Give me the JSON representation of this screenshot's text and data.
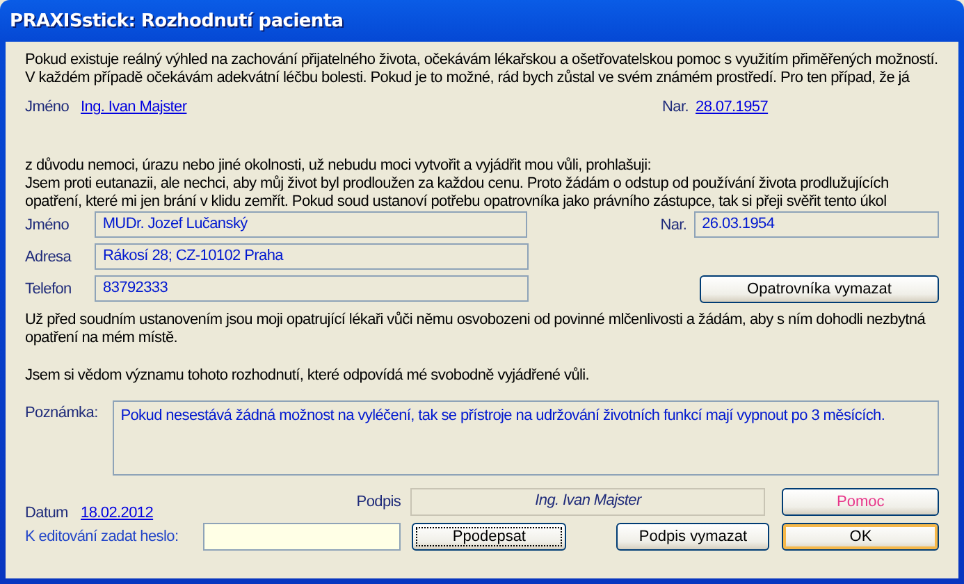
{
  "window": {
    "title": "PRAXISstick: Rozhodnutí pacienta"
  },
  "intro": "Pokud existuje reálný výhled na zachování přijatelného života, očekávám lékařskou a ošetřovatelskou pomoc s využitím přiměřených možností. V každém případě očekávám adekvátní léčbu bolesti. Pokud je to možné, rád bych zůstal ve svém známém prostředí. Pro ten případ, že já",
  "patient": {
    "name_label": "Jméno",
    "name": "Ing. Ivan Majster",
    "birth_label": "Nar.",
    "birth": "28.07.1957"
  },
  "declaration_lead": "z důvodu nemoci, úrazu nebo jiné okolnosti, už nebudu moci vytvořit a vyjádřit mou vůli, prohlašuji:",
  "declaration": "Jsem proti eutanazii, ale nechci, aby můj život byl prodloužen za každou cenu. Proto žádám o odstup od používání života prodlužujících opatření, které mi jen brání v klidu zemřít. Pokud soud ustanoví potřebu opatrovníka jako právního zástupce, tak si přeji svěřit tento úkol",
  "guardian": {
    "fields": [
      {
        "label": "Jméno",
        "value": "MUDr. Jozef Lučanský"
      },
      {
        "label": "Adresa",
        "value": "Rákosí 28; CZ-10102 Praha"
      },
      {
        "label": "Telefon",
        "value": "83792333"
      }
    ],
    "birth_label": "Nar.",
    "birth": "26.03.1954",
    "clear_button": "Opatrovníka vymazat"
  },
  "release_text": "Už před soudním ustanovením jsou moji opatrující lékaři vůči němu osvobozeni od povinné mlčenlivosti a žádám, aby s ním dohodli nezbytná opatření na mém místě.",
  "confirmation": "Jsem si vědom významu tohoto rozhodnutí, které odpovídá mé svobodně vyjádřené vůli.",
  "note": {
    "label": "Poznámka:",
    "value": "Pokud nesestává žádná možnost na vyléčení, tak se přístroje na udržování životních funkcí mají vypnout po 3 měsících."
  },
  "date": {
    "label": "Datum",
    "value": "18.02.2012"
  },
  "signature": {
    "label": "Podpis",
    "value": "Ing. Ivan Majster"
  },
  "password": {
    "label": "K editování zadat heslo:"
  },
  "buttons": [
    {
      "label": "Pomoc",
      "kind": "help",
      "focused": false,
      "default": false
    },
    {
      "label": "Ppodepsat",
      "kind": "normal",
      "focused": true,
      "default": false
    },
    {
      "label": "Podpis vymazat",
      "kind": "normal",
      "focused": false,
      "default": false
    },
    {
      "label": "OK",
      "kind": "normal",
      "focused": false,
      "default": true
    }
  ]
}
